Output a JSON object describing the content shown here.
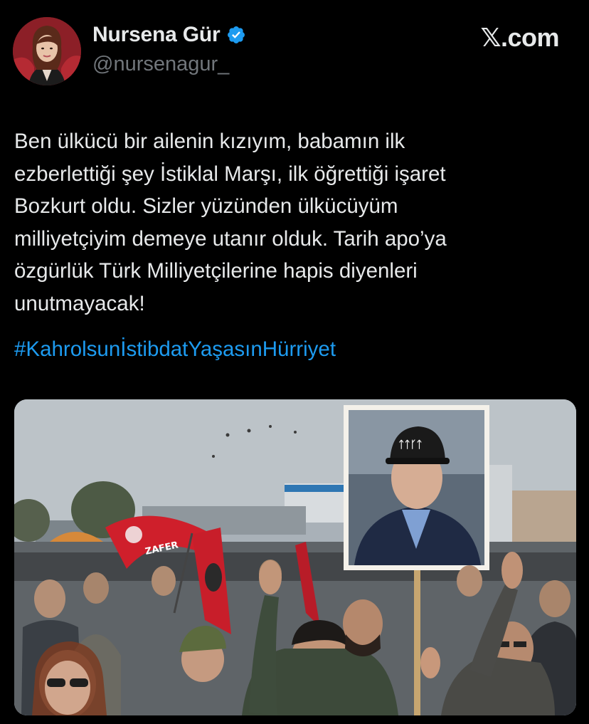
{
  "author": {
    "display_name": "Nursena Gür",
    "handle": "@nursenagur_",
    "verified": true
  },
  "source_label": "𝕏.com",
  "tweet": {
    "text": "Ben ülkücü bir ailenin kızıyım, babamın ilk\nezberlettiği şey İstiklal Marşı, ilk öğrettiği işaret\nBozkurt oldu. Sizler yüzünden ülkücüyüm\nmilliyetçiyim demeye utanır olduk. Tarih apo’ya\nözgürlük Türk Milliyetçilerine hapis diyenleri\nunutmayacak!",
    "hashtag": "#KahrolsunİstibdatYaşasınHürriyet"
  },
  "media": {
    "flag_text": "ZAFER",
    "cap_text": "ᛏᛏᚴᛏ"
  },
  "colors": {
    "background": "#000000",
    "text": "#e7e9ea",
    "muted": "#71767b",
    "link": "#1d9bf0",
    "verified_badge": "#1d9bf0"
  }
}
